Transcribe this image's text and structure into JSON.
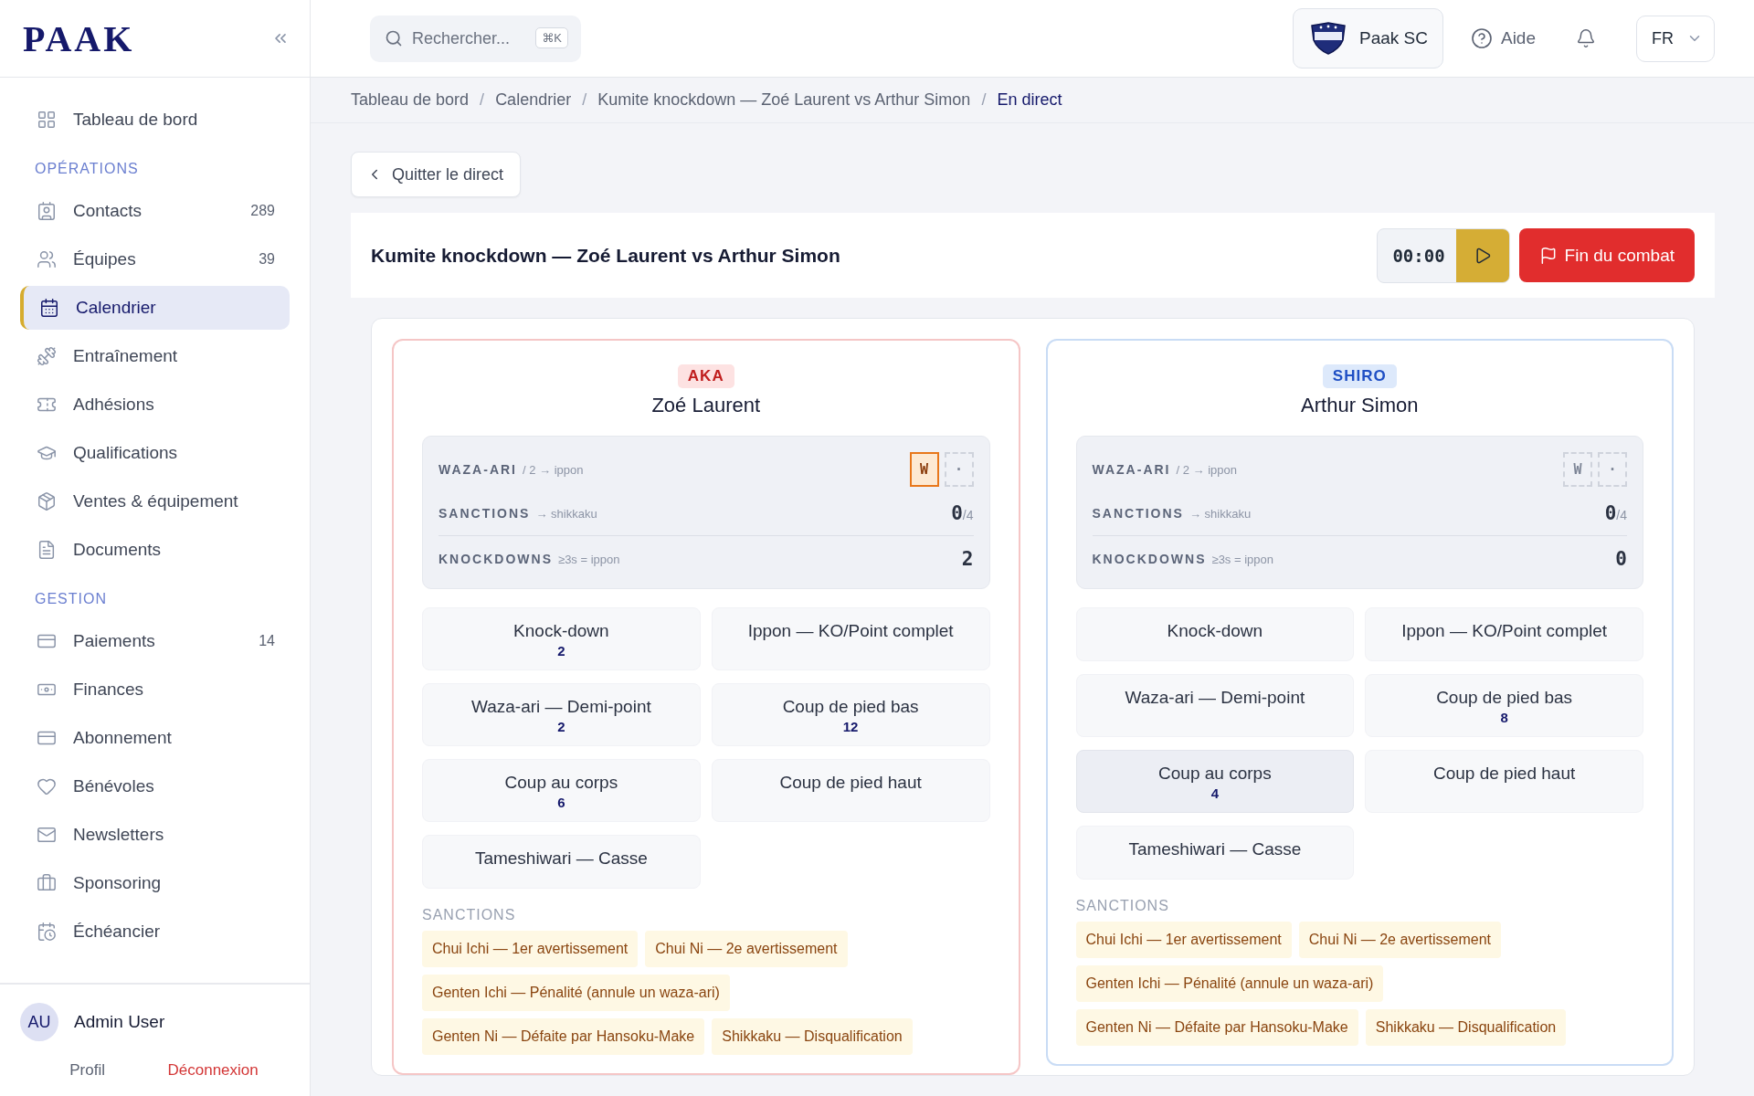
{
  "sidebar": {
    "logo": "PAAK",
    "sections": [
      {
        "items": [
          {
            "label": "Tableau de bord",
            "selected": false
          }
        ]
      },
      {
        "title": "OPÉRATIONS",
        "items": [
          {
            "label": "Contacts",
            "count": "289",
            "selected": false
          },
          {
            "label": "Équipes",
            "count": "39",
            "selected": false
          },
          {
            "label": "Calendrier",
            "selected": true
          },
          {
            "label": "Entraînement",
            "selected": false
          },
          {
            "label": "Adhésions",
            "selected": false
          },
          {
            "label": "Qualifications",
            "selected": false
          },
          {
            "label": "Ventes & équipement",
            "selected": false
          },
          {
            "label": "Documents",
            "selected": false
          }
        ]
      },
      {
        "title": "GESTION",
        "items": [
          {
            "label": "Paiements",
            "count": "14",
            "selected": false
          },
          {
            "label": "Finances",
            "selected": false
          },
          {
            "label": "Abonnement",
            "selected": false
          },
          {
            "label": "Bénévoles",
            "selected": false
          },
          {
            "label": "Newsletters",
            "selected": false
          },
          {
            "label": "Sponsoring",
            "selected": false
          },
          {
            "label": "Échéancier",
            "selected": false
          }
        ]
      }
    ],
    "user": {
      "initials": "AU",
      "name": "Admin User",
      "links": [
        {
          "label": "Profil",
          "kind": "default"
        },
        {
          "label": "Déconnexion",
          "kind": "danger"
        }
      ]
    }
  },
  "header": {
    "search": {
      "placeholder": "Rechercher...",
      "shortcut": "⌘K"
    },
    "club": "Paak SC",
    "help": "Aide",
    "language": "FR"
  },
  "breadcrumb": {
    "separator": "/",
    "items": [
      "Tableau de bord",
      "Calendrier",
      "Kumite knockdown — Zoé Laurent vs Arthur Simon",
      "En direct"
    ]
  },
  "back_button": "Quitter le direct",
  "match": {
    "title": "Kumite knockdown — Zoé Laurent vs Arthur Simon",
    "timer": "00:00",
    "end_button": "Fin du combat"
  },
  "fighters": [
    {
      "kind": "aka",
      "tag": "AKA",
      "name": "Zoé Laurent",
      "waza_ari": {
        "label": "WAZA-ARI",
        "hint": "/ 2 → ippon",
        "marks": [
          {
            "text": "W",
            "filled": true
          },
          {
            "text": "·",
            "filled": false
          }
        ]
      },
      "sanctions": {
        "label": "SANCTIONS",
        "hint": "→ shikkaku",
        "value": "0",
        "max": "/4"
      },
      "knockdowns": {
        "label": "KNOCKDOWNS",
        "hint": "≥3s = ippon",
        "value": "2"
      },
      "actions": [
        {
          "label": "Knock-down",
          "count": "2",
          "active": false
        },
        {
          "label": "Ippon — KO/Point complet",
          "active": false
        },
        {
          "label": "Waza-ari — Demi-point",
          "count": "2",
          "active": false
        },
        {
          "label": "Coup de pied bas",
          "count": "12",
          "active": false
        },
        {
          "label": "Coup au corps",
          "count": "6",
          "active": false
        },
        {
          "label": "Coup de pied haut",
          "active": false
        },
        {
          "label": "Tameshiwari — Casse",
          "active": false
        }
      ],
      "sanctions_title": "SANCTIONS",
      "sanction_buttons": [
        "Chui Ichi — 1er avertissement",
        "Chui Ni — 2e avertissement",
        "Genten Ichi — Pénalité (annule un waza-ari)",
        "Genten Ni — Défaite par Hansoku-Make",
        "Shikkaku — Disqualification"
      ]
    },
    {
      "kind": "shiro",
      "tag": "SHIRO",
      "name": "Arthur Simon",
      "waza_ari": {
        "label": "WAZA-ARI",
        "hint": "/ 2 → ippon",
        "marks": [
          {
            "text": "W",
            "filled": false
          },
          {
            "text": "·",
            "filled": false
          }
        ]
      },
      "sanctions": {
        "label": "SANCTIONS",
        "hint": "→ shikkaku",
        "value": "0",
        "max": "/4"
      },
      "knockdowns": {
        "label": "KNOCKDOWNS",
        "hint": "≥3s = ippon",
        "value": "0"
      },
      "actions": [
        {
          "label": "Knock-down",
          "active": false
        },
        {
          "label": "Ippon — KO/Point complet",
          "active": false
        },
        {
          "label": "Waza-ari — Demi-point",
          "active": false
        },
        {
          "label": "Coup de pied bas",
          "count": "8",
          "active": false
        },
        {
          "label": "Coup au corps",
          "count": "4",
          "active": true
        },
        {
          "label": "Coup de pied haut",
          "active": false
        },
        {
          "label": "Tameshiwari — Casse",
          "active": false
        }
      ],
      "sanctions_title": "SANCTIONS",
      "sanction_buttons": [
        "Chui Ichi — 1er avertissement",
        "Chui Ni — 2e avertissement",
        "Genten Ichi — Pénalité (annule un waza-ari)",
        "Genten Ni — Défaite par Hansoku-Make",
        "Shikkaku — Disqualification"
      ]
    }
  ]
}
